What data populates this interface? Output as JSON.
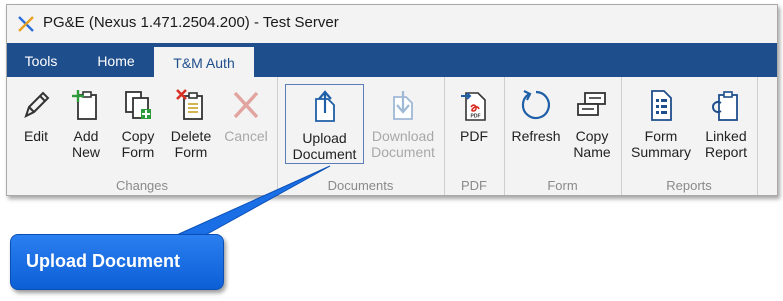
{
  "window": {
    "title": "PG&E (Nexus 1.471.2504.200) - Test Server"
  },
  "tabs": [
    {
      "label": "Tools"
    },
    {
      "label": "Home"
    },
    {
      "label": "T&M Auth",
      "active": true
    }
  ],
  "groups": {
    "changes": {
      "label": "Changes",
      "edit": [
        "Edit"
      ],
      "add_new": [
        "Add",
        "New"
      ],
      "copy_form": [
        "Copy",
        "Form"
      ],
      "delete_form": [
        "Delete",
        "Form"
      ],
      "cancel": [
        "Cancel"
      ]
    },
    "documents": {
      "label": "Documents",
      "upload": [
        "Upload",
        "Document"
      ],
      "download": [
        "Download",
        "Document"
      ]
    },
    "pdf": {
      "label": "PDF",
      "pdf": [
        "PDF"
      ]
    },
    "form": {
      "label": "Form",
      "refresh": [
        "Refresh"
      ],
      "copy_name": [
        "Copy",
        "Name"
      ]
    },
    "reports": {
      "label": "Reports",
      "form_summary": [
        "Form",
        "Summary"
      ],
      "linked_report": [
        "Linked",
        "Report"
      ]
    }
  },
  "callout": {
    "text": "Upload Document"
  },
  "icon_names": [
    "pencil-icon",
    "add-new-icon",
    "copy-form-icon",
    "delete-form-icon",
    "cancel-icon",
    "upload-icon",
    "download-icon",
    "pdf-icon",
    "refresh-icon",
    "copy-name-icon",
    "form-summary-icon",
    "linked-report-icon"
  ],
  "colors": {
    "tab_bar": "#1f4e8c",
    "icon_blue": "#1f5fa8",
    "callout": "#1a6fe6",
    "delete_red": "#d93025",
    "add_green": "#2e9b3a"
  }
}
